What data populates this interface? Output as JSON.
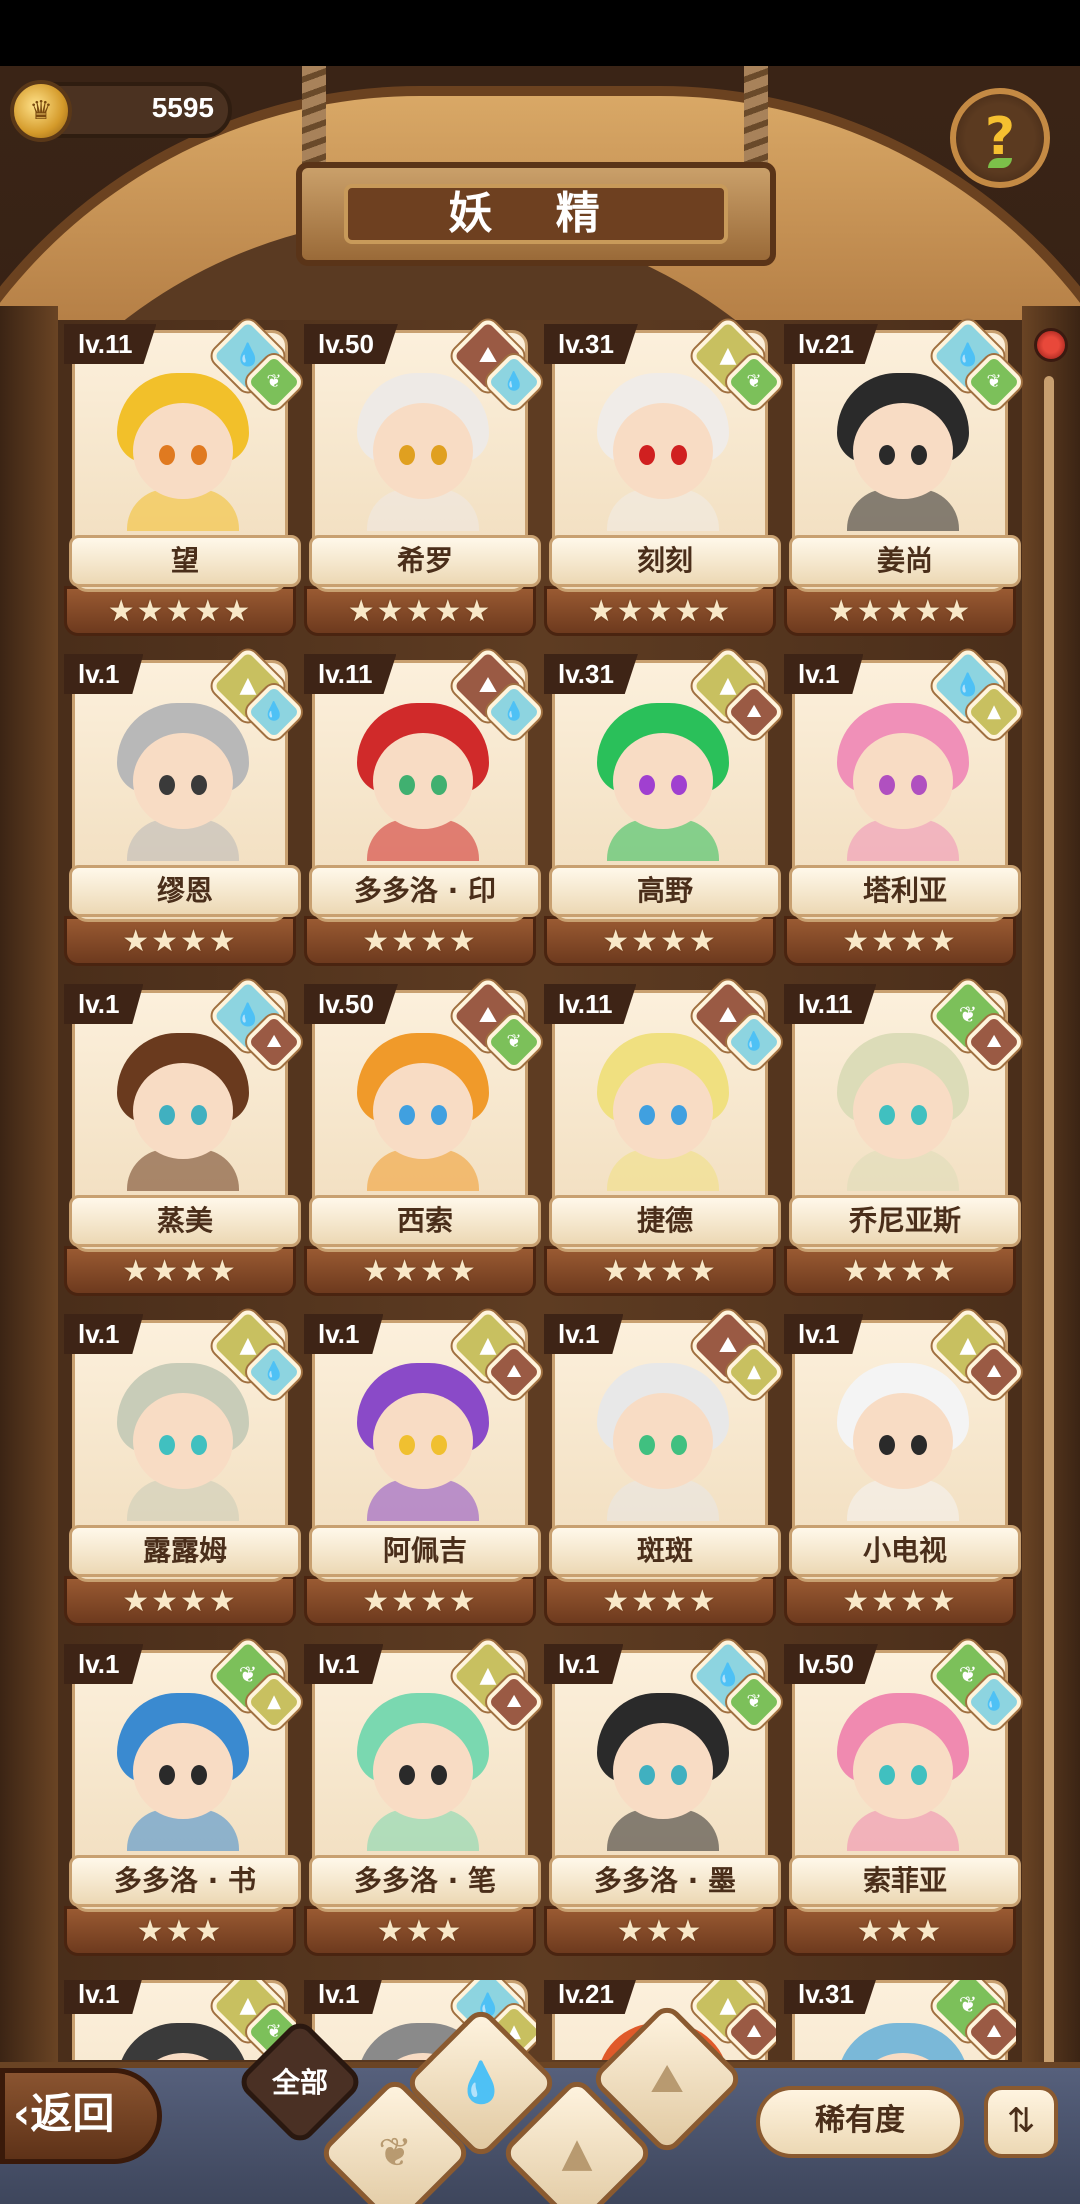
{
  "header": {
    "currency_value": "5595",
    "currency_icon": "crown-coin-icon",
    "title": "妖 精",
    "help_label": "?"
  },
  "spirits": [
    {
      "level": "lv.11",
      "name": "望",
      "stars": "★★★★★",
      "elements": [
        "water",
        "plant"
      ],
      "hair": "#f2c02a",
      "eyes": "#e07a20"
    },
    {
      "level": "lv.50",
      "name": "希罗",
      "stars": "★★★★★",
      "elements": [
        "mountain",
        "water"
      ],
      "hair": "#eeeae6",
      "eyes": "#e0a020"
    },
    {
      "level": "lv.31",
      "name": "刻刻",
      "stars": "★★★★★",
      "elements": [
        "earth",
        "plant"
      ],
      "hair": "#f0ece8",
      "eyes": "#d02020"
    },
    {
      "level": "lv.21",
      "name": "姜尚",
      "stars": "★★★★★",
      "elements": [
        "water",
        "plant"
      ],
      "hair": "#2a2a2a",
      "eyes": "#2a2a2a"
    },
    {
      "level": "lv.1",
      "name": "缪恩",
      "stars": "★★★★",
      "elements": [
        "earth",
        "water"
      ],
      "hair": "#b8b8b8",
      "eyes": "#3a3a3a"
    },
    {
      "level": "lv.11",
      "name": "多多洛 · 印",
      "stars": "★★★★",
      "elements": [
        "mountain",
        "water"
      ],
      "hair": "#d02a2a",
      "eyes": "#40b070"
    },
    {
      "level": "lv.31",
      "name": "高野",
      "stars": "★★★★",
      "elements": [
        "earth",
        "mountain"
      ],
      "hair": "#2ac05a",
      "eyes": "#a040d0"
    },
    {
      "level": "lv.1",
      "name": "塔利亚",
      "stars": "★★★★",
      "elements": [
        "water",
        "earth"
      ],
      "hair": "#f090b8",
      "eyes": "#b050c0"
    },
    {
      "level": "lv.1",
      "name": "蒸美",
      "stars": "★★★★",
      "elements": [
        "water",
        "mountain"
      ],
      "hair": "#6a3a1e",
      "eyes": "#40b0c0"
    },
    {
      "level": "lv.50",
      "name": "西索",
      "stars": "★★★★",
      "elements": [
        "mountain",
        "plant"
      ],
      "hair": "#f09a2a",
      "eyes": "#40a0e0"
    },
    {
      "level": "lv.11",
      "name": "捷德",
      "stars": "★★★★",
      "elements": [
        "mountain",
        "water"
      ],
      "hair": "#f0e080",
      "eyes": "#40a0e0"
    },
    {
      "level": "lv.11",
      "name": "乔尼亚斯",
      "stars": "★★★★",
      "elements": [
        "plant",
        "mountain"
      ],
      "hair": "#dcdcb8",
      "eyes": "#40c0c0"
    },
    {
      "level": "lv.1",
      "name": "露露姆",
      "stars": "★★★★",
      "elements": [
        "earth",
        "water"
      ],
      "hair": "#c8ccb8",
      "eyes": "#40c0c0"
    },
    {
      "level": "lv.1",
      "name": "阿佩吉",
      "stars": "★★★★",
      "elements": [
        "earth",
        "mountain"
      ],
      "hair": "#8a4ac8",
      "eyes": "#f0c030"
    },
    {
      "level": "lv.1",
      "name": "斑斑",
      "stars": "★★★★",
      "elements": [
        "mountain",
        "earth"
      ],
      "hair": "#e8e8e8",
      "eyes": "#40c080"
    },
    {
      "level": "lv.1",
      "name": "小电视",
      "stars": "★★★★",
      "elements": [
        "earth",
        "mountain"
      ],
      "hair": "#f4f4f4",
      "eyes": "#2a2a2a"
    },
    {
      "level": "lv.1",
      "name": "多多洛 · 书",
      "stars": "★★★",
      "elements": [
        "plant",
        "earth"
      ],
      "hair": "#3a8ad0",
      "eyes": "#2a2a2a"
    },
    {
      "level": "lv.1",
      "name": "多多洛 · 笔",
      "stars": "★★★",
      "elements": [
        "earth",
        "mountain"
      ],
      "hair": "#7ad8b0",
      "eyes": "#2a2a2a"
    },
    {
      "level": "lv.1",
      "name": "多多洛 · 墨",
      "stars": "★★★",
      "elements": [
        "water",
        "plant"
      ],
      "hair": "#2a2a2a",
      "eyes": "#40b0c0"
    },
    {
      "level": "lv.50",
      "name": "索菲亚",
      "stars": "★★★",
      "elements": [
        "plant",
        "water"
      ],
      "hair": "#f08ab0",
      "eyes": "#40c0c0"
    },
    {
      "level": "lv.1",
      "name": "",
      "stars": "",
      "elements": [
        "earth",
        "plant"
      ],
      "hair": "#3a3a3a",
      "eyes": "#3a3a3a"
    },
    {
      "level": "lv.1",
      "name": "",
      "stars": "",
      "elements": [
        "water",
        "earth"
      ],
      "hair": "#8a8a8a",
      "eyes": "#3a3a3a"
    },
    {
      "level": "lv.21",
      "name": "",
      "stars": "",
      "elements": [
        "earth",
        "mountain"
      ],
      "hair": "#e05a2a",
      "eyes": "#3a3a3a"
    },
    {
      "level": "lv.31",
      "name": "",
      "stars": "",
      "elements": [
        "plant",
        "mountain"
      ],
      "hair": "#7ab8d8",
      "eyes": "#3a3a3a"
    }
  ],
  "element_icons": {
    "water": "water-drop-icon",
    "mountain": "mountain-icon",
    "earth": "earth-icon",
    "plant": "sprout-icon"
  },
  "footer": {
    "back_label": "返回",
    "tabs": [
      {
        "label": "全部",
        "icon": "all-tab"
      },
      {
        "label": "",
        "icon": "sprout-icon"
      },
      {
        "label": "",
        "icon": "water-drop-icon"
      },
      {
        "label": "",
        "icon": "earth-icon"
      },
      {
        "label": "",
        "icon": "mountain-icon"
      }
    ],
    "rarity_label": "稀有度",
    "sort_icon": "sort-order-icon"
  }
}
